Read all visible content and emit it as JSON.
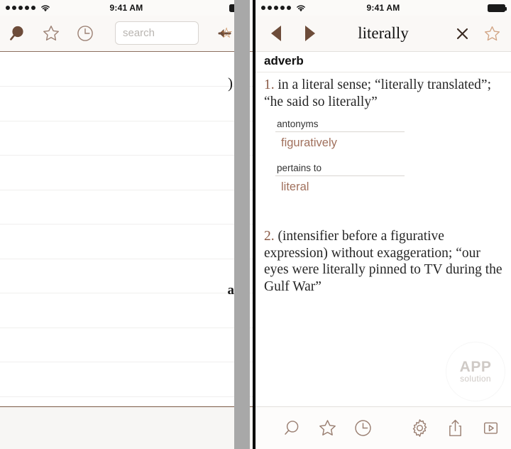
{
  "status_bar": {
    "signal_dots": 5,
    "wifi_icon": "wifi-icon",
    "time": "9:41 AM",
    "battery_icon": "battery-full-icon"
  },
  "left_panel": {
    "header": {
      "search_tab_icon": "search-filled-icon",
      "favorites_tab_icon": "star-outline-icon",
      "history_tab_icon": "clock-outline-icon",
      "search_value": "",
      "search_placeholder": "search",
      "back_icon": "arrow-left-icon"
    },
    "list_rows": [
      "",
      "",
      "",
      "",
      "",
      "",
      "",
      "",
      "",
      ""
    ],
    "ghost_glyph_top": ")",
    "ghost_glyph_mid": "a"
  },
  "right_panel": {
    "header": {
      "prev_icon": "triangle-left-icon",
      "next_icon": "triangle-right-icon",
      "title": "literally",
      "close_icon": "close-x-icon",
      "favorite_icon": "star-outline-icon"
    },
    "part_of_speech": "adverb",
    "senses": [
      {
        "number": "1.",
        "definition": "in a literal sense; “literally translated”; “he said so literally”",
        "relations": [
          {
            "label": "antonyms",
            "words": [
              "figuratively"
            ]
          },
          {
            "label": "pertains to",
            "words": [
              "literal"
            ]
          }
        ]
      },
      {
        "number": "2.",
        "definition": "(intensifier before a figurative expression) without exaggeration; “our eyes were literally pinned to TV during the Gulf War”",
        "relations": []
      }
    ],
    "watermark": {
      "line1": "APP",
      "line2": "solution"
    },
    "toolbar": [
      {
        "name": "search",
        "icon": "search-outline-icon"
      },
      {
        "name": "favorites",
        "icon": "star-outline-icon"
      },
      {
        "name": "history",
        "icon": "clock-outline-icon"
      },
      {
        "name": "settings",
        "icon": "gear-icon"
      },
      {
        "name": "share",
        "icon": "share-up-icon"
      },
      {
        "name": "play",
        "icon": "play-box-icon"
      }
    ]
  },
  "colors": {
    "brand_brown": "#6d4c3a",
    "link_brown": "#a0705c",
    "icon_outline": "#9b8073",
    "sense_number": "#8a5a45",
    "header_bg": "#faf8f6",
    "divider": "#8d6f5e"
  }
}
